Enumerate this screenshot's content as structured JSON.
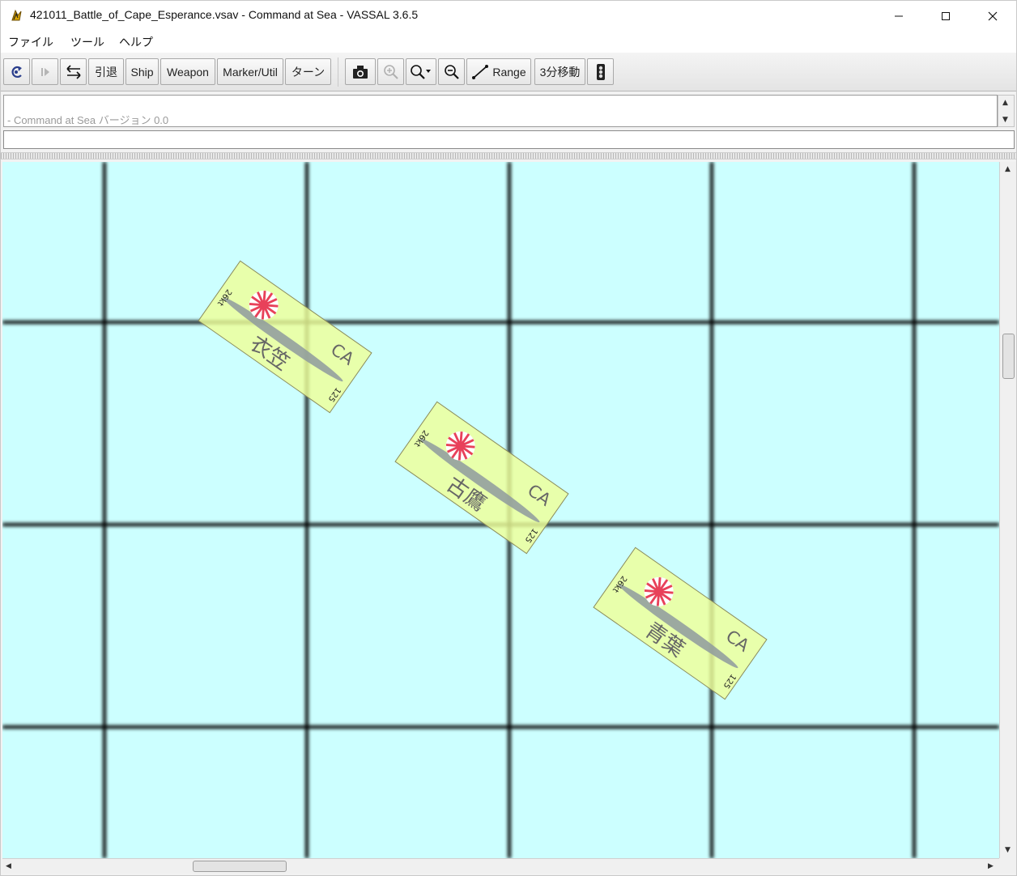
{
  "window": {
    "title": "421011_Battle_of_Cape_Esperance.vsav - Command at Sea - VASSAL 3.6.5",
    "app_icon": "vassal-icon",
    "controls": [
      "minimize-icon",
      "maximize-icon",
      "close-icon"
    ]
  },
  "menu": {
    "items": [
      {
        "label": "ファイル"
      },
      {
        "label": "ツール"
      },
      {
        "label": "ヘルプ"
      }
    ]
  },
  "toolbar": {
    "undo_icon": "undo-icon",
    "step_icon": "step-forward-icon",
    "swap_icon": "swap-arrows-icon",
    "retreat_label": "引退",
    "ship_label": "Ship",
    "weapon_label": "Weapon",
    "marker_label": "Marker/Util",
    "turn_label": "ターン",
    "screenshot_icon": "camera-icon",
    "zoom_in_icon": "zoom-in-icon",
    "zoom_select_icon": "zoom-select-icon",
    "zoom_out_icon": "zoom-out-icon",
    "range_label": "Range",
    "move_label": "3分移動",
    "traffic_icon": "traffic-light-icon"
  },
  "chat": {
    "log_line": "- Command at Sea バージョン 0.0",
    "input_value": ""
  },
  "map": {
    "background": "#ccffff",
    "grid_color": "#000000",
    "counters": [
      {
        "name": "衣笠",
        "type": "CA",
        "speed": "26kt",
        "points": "125",
        "flag": "rising-sun-flag-icon",
        "color": "#eeff99"
      },
      {
        "name": "古鷹",
        "type": "CA",
        "speed": "26kt",
        "points": "125",
        "flag": "rising-sun-flag-icon",
        "color": "#eeff99"
      },
      {
        "name": "青葉",
        "type": "CA",
        "speed": "26kt",
        "points": "125",
        "flag": "rising-sun-flag-icon",
        "color": "#eeff99"
      }
    ]
  }
}
